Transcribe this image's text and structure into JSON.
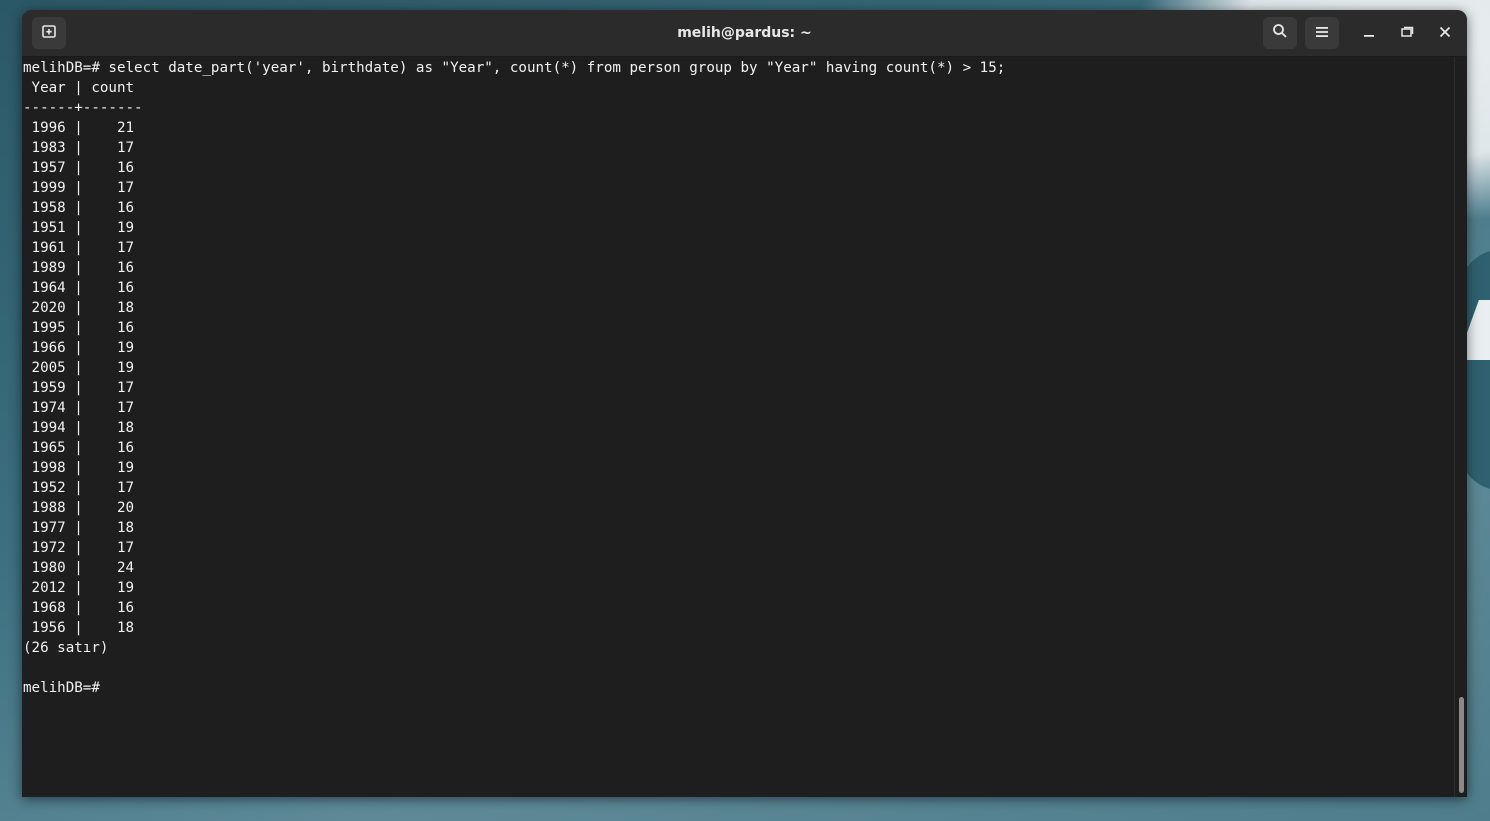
{
  "window": {
    "title": "melih@pardus: ~"
  },
  "icons": {
    "new_tab": "new-tab-icon",
    "search": "search-icon",
    "menu": "hamburger-menu-icon",
    "minimize": "minimize-icon",
    "maximize": "maximize-icon",
    "close": "close-icon"
  },
  "terminal": {
    "command_line": "melihDB=# select date_part('year', birthdate) as \"Year\", count(*) from person group by \"Year\" having count(*) > 15;",
    "header_line": " Year | count",
    "separator_line": "------+-------",
    "rows": [
      {
        "year": "1996",
        "count": "21"
      },
      {
        "year": "1983",
        "count": "17"
      },
      {
        "year": "1957",
        "count": "16"
      },
      {
        "year": "1999",
        "count": "17"
      },
      {
        "year": "1958",
        "count": "16"
      },
      {
        "year": "1951",
        "count": "19"
      },
      {
        "year": "1961",
        "count": "17"
      },
      {
        "year": "1989",
        "count": "16"
      },
      {
        "year": "1964",
        "count": "16"
      },
      {
        "year": "2020",
        "count": "18"
      },
      {
        "year": "1995",
        "count": "16"
      },
      {
        "year": "1966",
        "count": "19"
      },
      {
        "year": "2005",
        "count": "19"
      },
      {
        "year": "1959",
        "count": "17"
      },
      {
        "year": "1974",
        "count": "17"
      },
      {
        "year": "1994",
        "count": "18"
      },
      {
        "year": "1965",
        "count": "16"
      },
      {
        "year": "1998",
        "count": "19"
      },
      {
        "year": "1952",
        "count": "17"
      },
      {
        "year": "1988",
        "count": "20"
      },
      {
        "year": "1977",
        "count": "18"
      },
      {
        "year": "1972",
        "count": "17"
      },
      {
        "year": "1980",
        "count": "24"
      },
      {
        "year": "2012",
        "count": "19"
      },
      {
        "year": "1968",
        "count": "16"
      },
      {
        "year": "1956",
        "count": "18"
      }
    ],
    "row_count_line": "(26 satır)",
    "prompt": "melihDB=#"
  },
  "colors": {
    "terminal_bg": "#1e1e1e",
    "titlebar_bg": "#2b2b2b",
    "text": "#f2f2f2"
  }
}
